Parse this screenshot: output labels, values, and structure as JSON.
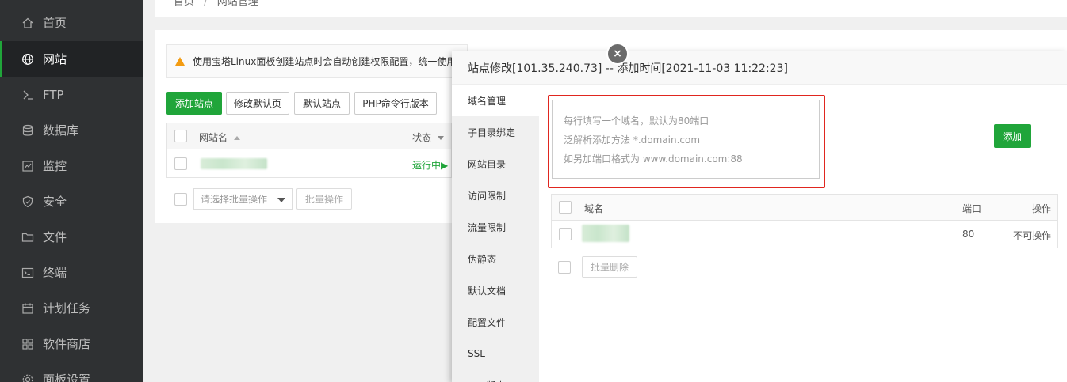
{
  "sidebar": {
    "items": [
      {
        "label": "首页",
        "icon": "home-icon"
      },
      {
        "label": "网站",
        "icon": "globe-icon",
        "active": true
      },
      {
        "label": "FTP",
        "icon": "ftp-icon"
      },
      {
        "label": "数据库",
        "icon": "database-icon"
      },
      {
        "label": "监控",
        "icon": "monitor-icon"
      },
      {
        "label": "安全",
        "icon": "shield-icon"
      },
      {
        "label": "文件",
        "icon": "folder-icon"
      },
      {
        "label": "终端",
        "icon": "terminal-icon"
      },
      {
        "label": "计划任务",
        "icon": "calendar-icon"
      },
      {
        "label": "软件商店",
        "icon": "grid-icon"
      },
      {
        "label": "面板设置",
        "icon": "gear-icon"
      }
    ]
  },
  "breadcrumb": {
    "home": "首页",
    "sep": "/",
    "current": "网站管理"
  },
  "page": {
    "notice": "使用宝塔Linux面板创建站点时会自动创建权限配置，统一使用",
    "toolbar": {
      "add_site": "添加站点",
      "modify_default": "修改默认页",
      "default_site": "默认站点",
      "php_cli": "PHP命令行版本"
    },
    "table": {
      "col_name": "网站名",
      "col_status": "状态",
      "row_status": "运行中▶"
    },
    "batch_select_placeholder": "请选择批量操作",
    "batch_button": "批量操作"
  },
  "modal": {
    "title": "站点修改[101.35.240.73] -- 添加时间[2021-11-03 11:22:23]",
    "close": "×",
    "tabs": [
      "域名管理",
      "子目录绑定",
      "网站目录",
      "访问限制",
      "流量限制",
      "伪静态",
      "默认文档",
      "配置文件",
      "SSL",
      "PHP版本"
    ],
    "active_tab": 0,
    "textarea_lines": [
      "每行填写一个域名，默认为80端口",
      "泛解析添加方法 *.domain.com",
      "如另加端口格式为 www.domain.com:88"
    ],
    "add_button": "添加",
    "domain_table": {
      "col_domain": "域名",
      "col_port": "端口",
      "col_action": "操作",
      "rows": [
        {
          "port": "80",
          "action": "不可操作"
        }
      ]
    },
    "batch_delete": "批量删除"
  },
  "colors": {
    "accent": "#20a53a",
    "highlight": "#e0261f",
    "sidebar": "#2f3133"
  }
}
